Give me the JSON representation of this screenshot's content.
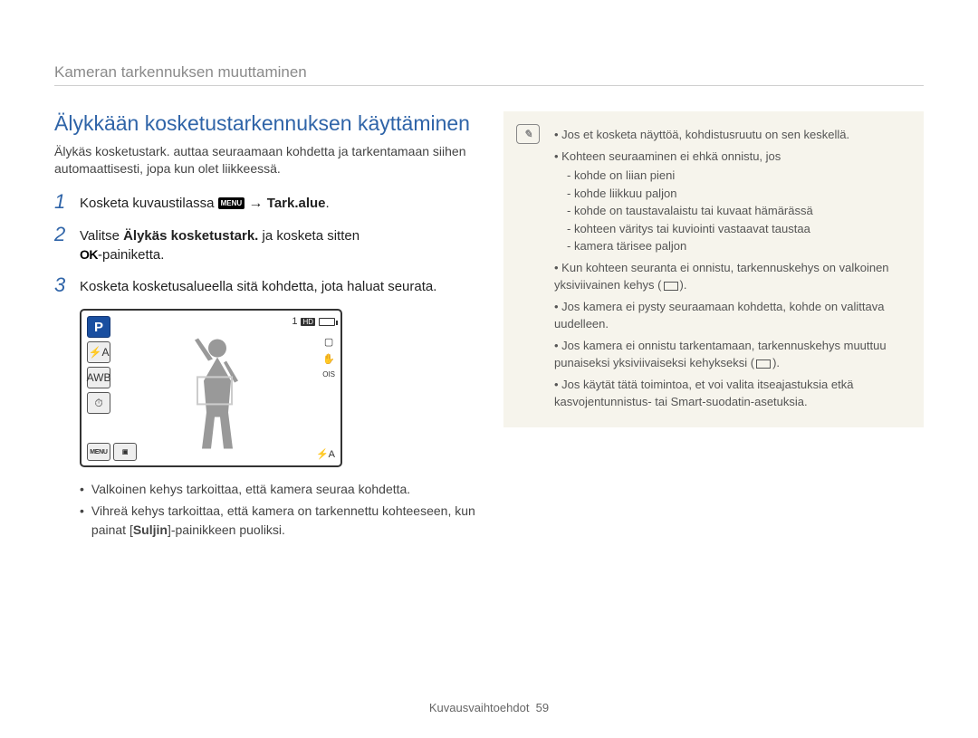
{
  "header": {
    "title": "Kameran tarkennuksen muuttaminen"
  },
  "section": {
    "title": "Älykkään kosketustarkennuksen käyttäminen",
    "intro": "Älykäs kosketustark. auttaa seuraamaan kohdetta ja tarkentamaan siihen automaattisesti, jopa kun olet liikkeessä."
  },
  "steps": [
    {
      "num": "1",
      "pre": "Kosketa kuvaustilassa ",
      "menu": "MENU",
      "arrow": " → ",
      "bold": "Tark.alue",
      "post": "."
    },
    {
      "num": "2",
      "pre": "Valitse ",
      "bold": "Älykäs kosketustark.",
      "mid": " ja kosketa sitten ",
      "ok": "OK",
      "post": "-painiketta."
    },
    {
      "num": "3",
      "text": "Kosketa kosketusalueella sitä kohdetta, jota haluat seurata."
    }
  ],
  "screen": {
    "mode": "P",
    "flash": "⚡A",
    "awb": "AWB",
    "timer": "⏱",
    "menu": "MENU",
    "play": "▣",
    "counter": "1",
    "hd": "HD",
    "rec_icon": "▢",
    "ois": "OIS",
    "hand": "✋",
    "flash_br": "⚡A"
  },
  "bullets": [
    "Valkoinen kehys tarkoittaa, että kamera seuraa kohdetta.",
    "Vihreä kehys tarkoittaa, että kamera on tarkennettu kohteeseen, kun painat [Suljin]-painikkeen puoliksi."
  ],
  "bullet_bold": "Suljin",
  "note": {
    "items": [
      {
        "text": "Jos et kosketa näyttöä, kohdistusruutu on sen keskellä."
      },
      {
        "text": "Kohteen seuraaminen ei ehkä onnistu, jos",
        "sub": [
          "kohde on liian pieni",
          "kohde liikkuu paljon",
          "kohde on taustavalaistu tai kuvaat hämärässä",
          "kohteen väritys tai kuviointi vastaavat taustaa",
          "kamera tärisee paljon"
        ]
      },
      {
        "text_pre": "Kun kohteen seuranta ei onnistu, tarkennuskehys on valkoinen yksiviivainen kehys (",
        "rect": true,
        "text_post": ")."
      },
      {
        "text": "Jos kamera ei pysty seuraamaan kohdetta, kohde on valittava uudelleen."
      },
      {
        "text_pre": "Jos kamera ei onnistu tarkentamaan, tarkennuskehys muuttuu punaiseksi yksiviivaiseksi kehykseksi (",
        "rect": true,
        "text_post": ")."
      },
      {
        "text": "Jos käytät tätä toimintoa, et voi valita itseajastuksia etkä kasvojentunnistus- tai Smart-suodatin-asetuksia."
      }
    ]
  },
  "footer": {
    "section": "Kuvausvaihtoehdot",
    "page": "59"
  }
}
